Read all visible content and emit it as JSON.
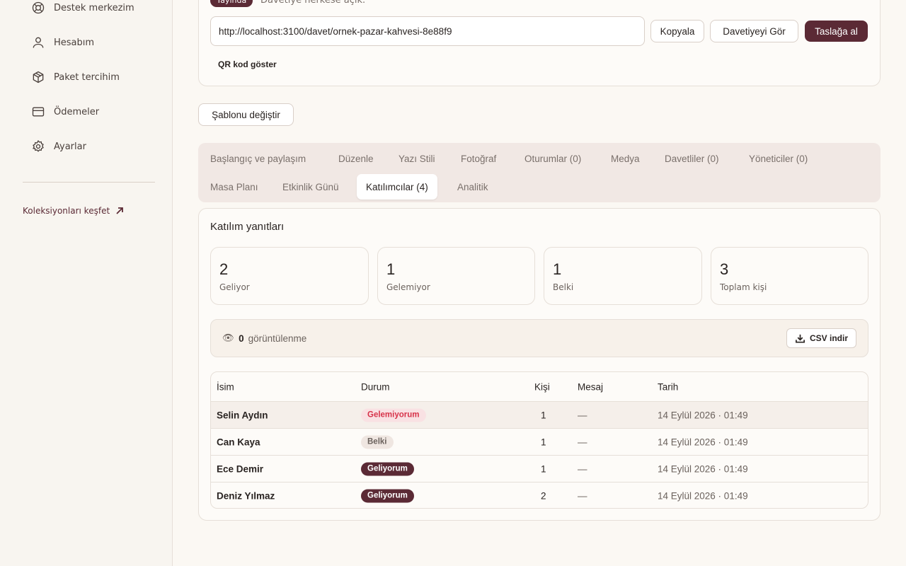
{
  "sidebar": {
    "items": [
      {
        "label": "Destek merkezim",
        "icon": "lifebuoy-icon"
      },
      {
        "label": "Hesabım",
        "icon": "user-icon"
      },
      {
        "label": "Paket tercihim",
        "icon": "package-icon"
      },
      {
        "label": "Ödemeler",
        "icon": "credit-card-icon"
      },
      {
        "label": "Ayarlar",
        "icon": "gear-icon"
      }
    ],
    "explore_link": "Koleksiyonları keşfet"
  },
  "invite": {
    "status_badge": "Yayında",
    "status_text": "Davetiye herkese açık.",
    "url": "http://localhost:3100/davet/ornek-pazar-kahvesi-8e88f9",
    "copy_label": "Kopyala",
    "view_label": "Davetiyeyi Gör",
    "draft_label": "Taslağa al",
    "qr_label": "QR kod göster"
  },
  "template_button": "Şablonu değiştir",
  "tabs": [
    {
      "label": "Başlangıç ve paylaşım"
    },
    {
      "label": "Düzenle"
    },
    {
      "label": "Yazı Stili"
    },
    {
      "label": "Fotoğraf"
    },
    {
      "label": "Oturumlar (0)"
    },
    {
      "label": "Medya"
    },
    {
      "label": "Davetliler (0)"
    },
    {
      "label": "Yöneticiler (0)"
    },
    {
      "label": "Masa Planı"
    },
    {
      "label": "Etkinlik Günü"
    },
    {
      "label": "Katılımcılar (4)"
    },
    {
      "label": "Analitik"
    }
  ],
  "active_tab": "Katılımcılar (4)",
  "panel": {
    "title": "Katılım yanıtları",
    "stats": [
      {
        "value": "2",
        "label": "Geliyor"
      },
      {
        "value": "1",
        "label": "Gelemiyor"
      },
      {
        "value": "1",
        "label": "Belki"
      },
      {
        "value": "3",
        "label": "Toplam kişi"
      }
    ],
    "views_icon": "👁",
    "views_count": "0",
    "views_label": "görüntülenme",
    "csv_label": "CSV indir"
  },
  "table": {
    "headers": {
      "name": "İsim",
      "status": "Durum",
      "count": "Kişi",
      "message": "Mesaj",
      "date": "Tarih"
    },
    "rows": [
      {
        "name": "Selin Aydın",
        "status": "Gelemiyorum",
        "count": "1",
        "message": "—",
        "date": "14 Eylül 2026 · 01:49"
      },
      {
        "name": "Can Kaya",
        "status": "Belki",
        "count": "1",
        "message": "—",
        "date": "14 Eylül 2026 · 01:49"
      },
      {
        "name": "Ece Demir",
        "status": "Geliyorum",
        "count": "1",
        "message": "—",
        "date": "14 Eylül 2026 · 01:49"
      },
      {
        "name": "Deniz Yılmaz",
        "status": "Geliyorum",
        "count": "2",
        "message": "—",
        "date": "14 Eylül 2026 · 01:49"
      }
    ]
  },
  "colors": {
    "accent": "#5b2a35",
    "negative": "#d7334a",
    "background": "#fbf8f3"
  }
}
